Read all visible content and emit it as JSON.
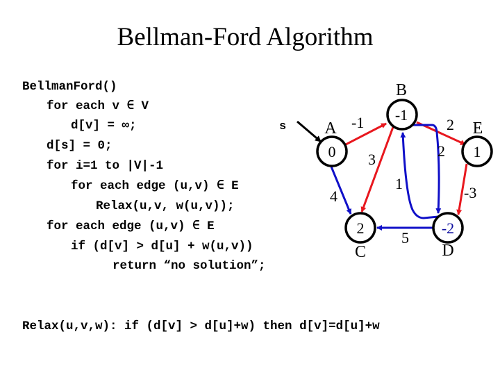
{
  "title": "Bellman-Ford Algorithm",
  "pseudocode": {
    "lines": [
      "BellmanFord()",
      "for each v ∈ V",
      "d[v] = ∞;",
      "d[s] = 0;",
      "for i=1 to |V|-1",
      "for each edge (u,v) ∈ E",
      "Relax(u,v, w(u,v));",
      "for each edge (u,v) ∈ E",
      "if (d[v] > d[u] + w(u,v))",
      "return “no solution”;"
    ]
  },
  "relax_definition": "Relax(u,v,w): if (d[v] > d[u]+w) then d[v]=d[u]+w",
  "graph": {
    "source_label": "s",
    "nodes": [
      {
        "id": "A",
        "label": "A",
        "value": "0"
      },
      {
        "id": "B",
        "label": "B",
        "value": "-1"
      },
      {
        "id": "C",
        "label": "C",
        "value": "2"
      },
      {
        "id": "D",
        "label": "D",
        "value": "-2"
      },
      {
        "id": "E",
        "label": "E",
        "value": "1"
      }
    ],
    "edges": [
      {
        "from": "A",
        "to": "B",
        "weight": "-1",
        "color": "#e8171e"
      },
      {
        "from": "B",
        "to": "E",
        "weight": "2",
        "color": "#e8171e"
      },
      {
        "from": "B",
        "to": "C",
        "weight": "3",
        "color": "#e8171e"
      },
      {
        "from": "A",
        "to": "C",
        "weight": "4",
        "color": "#1010c8"
      },
      {
        "from": "D",
        "to": "B",
        "weight": "1",
        "color": "#1010c8"
      },
      {
        "from": "B",
        "to": "D",
        "weight": "2",
        "color": "#1010c8"
      },
      {
        "from": "E",
        "to": "D",
        "weight": "-3",
        "color": "#e8171e"
      },
      {
        "from": "D",
        "to": "C",
        "weight": "5",
        "color": "#1010c8"
      }
    ],
    "colors": {
      "red_edge": "#e8171e",
      "blue_edge": "#1010c8",
      "highlight_value": "#1010a0"
    }
  }
}
